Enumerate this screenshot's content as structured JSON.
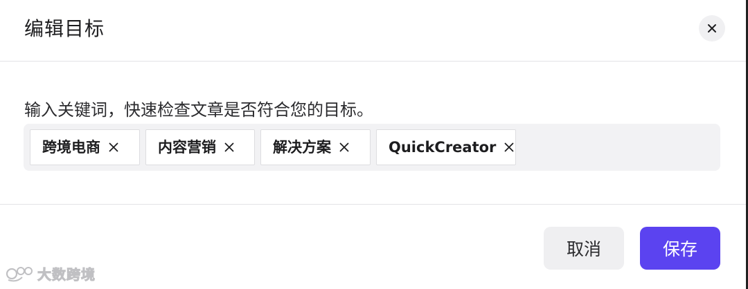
{
  "dialog": {
    "title": "编辑目标",
    "close_icon": "close-icon"
  },
  "body": {
    "hint": "输入关键词，快速检查文章是否符合您的目标。",
    "tags": [
      {
        "label": "跨境电商"
      },
      {
        "label": "内容营销"
      },
      {
        "label": "解决方案"
      },
      {
        "label": "QuickCreator"
      }
    ]
  },
  "footer": {
    "cancel_label": "取消",
    "save_label": "保存"
  },
  "watermark": {
    "text": "大数跨境"
  },
  "colors": {
    "accent": "#5b43f0",
    "cancel_bg": "#efeff1",
    "tag_area_bg": "#f2f2f4",
    "divider": "#e3e3e6"
  }
}
